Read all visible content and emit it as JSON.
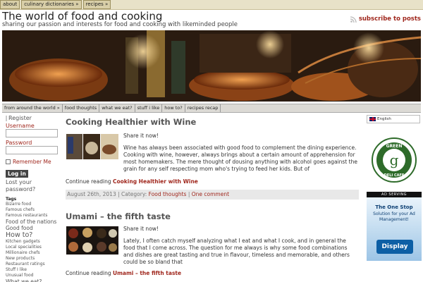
{
  "topnav": [
    {
      "label": "about"
    },
    {
      "label": "culinary dictionaries »"
    },
    {
      "label": "recipes »"
    }
  ],
  "site": {
    "title": "The world of food and cooking",
    "tagline": "sharing our passion and interests for food and cooking with likeminded people",
    "subscribe": "subscribe to posts"
  },
  "subnav": [
    {
      "label": "from around the world »"
    },
    {
      "label": "food thoughts"
    },
    {
      "label": "what we eat?"
    },
    {
      "label": "stuff i like"
    },
    {
      "label": "how to?"
    },
    {
      "label": "recipes recap"
    }
  ],
  "sidebar": {
    "register": "Register",
    "username_label": "Username",
    "password_label": "Password",
    "remember": "Remember Me",
    "login": "Log in",
    "lost": "Lost your password?",
    "tags_heading": "Tags",
    "tags": [
      {
        "label": "Bizarre food",
        "size": "small"
      },
      {
        "label": "Famous chefs",
        "size": "small"
      },
      {
        "label": "Famous restaurants",
        "size": "small"
      },
      {
        "label": "Food of the nations",
        "size": "medium"
      },
      {
        "label": "Good food",
        "size": "medium"
      },
      {
        "label": "How to?",
        "size": "large"
      },
      {
        "label": "Kitchen gadgets",
        "size": "small"
      },
      {
        "label": "Local specialities",
        "size": "small"
      },
      {
        "label": "Millionaire chefs",
        "size": "small"
      },
      {
        "label": "New products",
        "size": "small"
      },
      {
        "label": "Restaurant ratings",
        "size": "small"
      },
      {
        "label": "Stuff I like",
        "size": "small"
      },
      {
        "label": "Unusual food",
        "size": "small"
      },
      {
        "label": "What we eat?",
        "size": "medium"
      }
    ]
  },
  "posts": [
    {
      "title": "Cooking Healthier with Wine",
      "share": "Share it now!",
      "excerpt": "Wine has always been associated with good food to complement the dining experience. Cooking with wine, however, always brings about a certain amount of apprehension for most homemakers. The mere thought of dousing anything with alcohol goes against the grain for any self respecting mom who's trying to feed her kids. But of",
      "continue_prefix": "Continue reading",
      "continue_link": "Cooking Healthier with Wine",
      "date": "August 26th, 2013",
      "category_prefix": "Category:",
      "category": "Food thoughts",
      "comments": "One comment"
    },
    {
      "title": "Umami – the fifth taste",
      "share": "Share it now!",
      "excerpt": "Lately, I often catch myself analyzing what I eat and what I cook, and in general the food that I come across. The question for me always is why some food combinations and dishes are great tasting and true in flavour, timeless and memorable, and others could be so bland that",
      "continue_prefix": "Continue reading",
      "continue_link": "Umami – the fifth taste"
    }
  ],
  "right": {
    "language": "English",
    "logo_top": "GREEN",
    "logo_bottom": "DELI CAFE",
    "ad_label": "AD SERVING",
    "ad_line1": "The One Stop",
    "ad_line2": "Solution for your Ad Management!",
    "ad_button": "Display"
  },
  "colors": {
    "accent": "#a0281e",
    "nav_bg": "#d9cfa8",
    "subnav_bg": "#dcdad5"
  }
}
